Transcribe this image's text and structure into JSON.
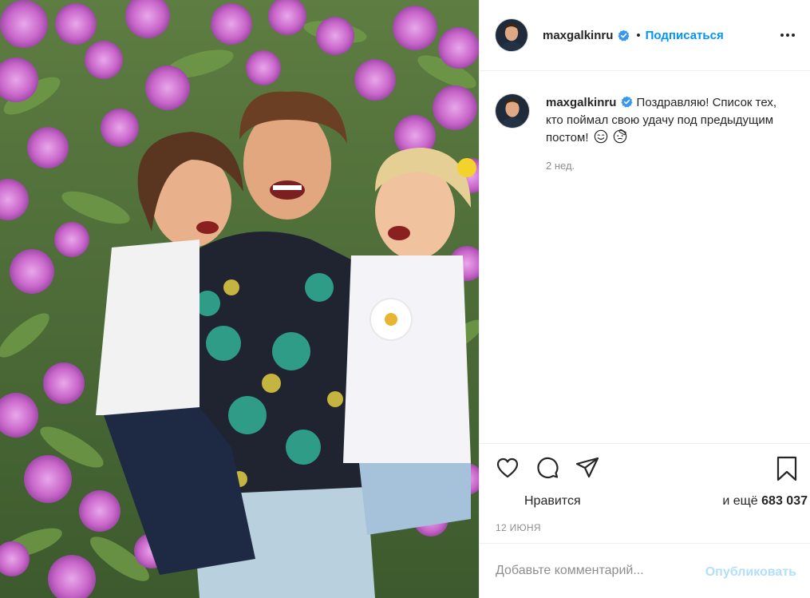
{
  "post": {
    "photo_icon": "photo-of-man-with-two-children-among-pink-flowers"
  },
  "header": {
    "username": "maxgalkinru",
    "verified_icon": "verified-badge-icon",
    "separator": "•",
    "follow_label": "Подписаться",
    "more_icon": "more-options-icon"
  },
  "caption": {
    "username": "maxgalkinru",
    "text": "Поздравляю! Список тех, кто поймал свою удачу под предыдущим постом!",
    "emojis": [
      "smiling-face-emoji",
      "face-with-bandage-emoji"
    ],
    "time": "2 нед."
  },
  "actions": {
    "like_icon": "heart-icon",
    "comment_icon": "comment-bubble-icon",
    "share_icon": "paper-plane-icon",
    "save_icon": "bookmark-icon"
  },
  "likes": {
    "liked_by": "Нравится",
    "and_more": "и ещё",
    "count": "683 037"
  },
  "date": "12 ИЮНЯ",
  "comment": {
    "placeholder": "Добавьте комментарий...",
    "publish_label": "Опубликовать"
  },
  "colors": {
    "accent": "#0095f6",
    "publish_disabled": "#b2dffc",
    "muted": "#8e8e8e",
    "border": "#efefef"
  }
}
